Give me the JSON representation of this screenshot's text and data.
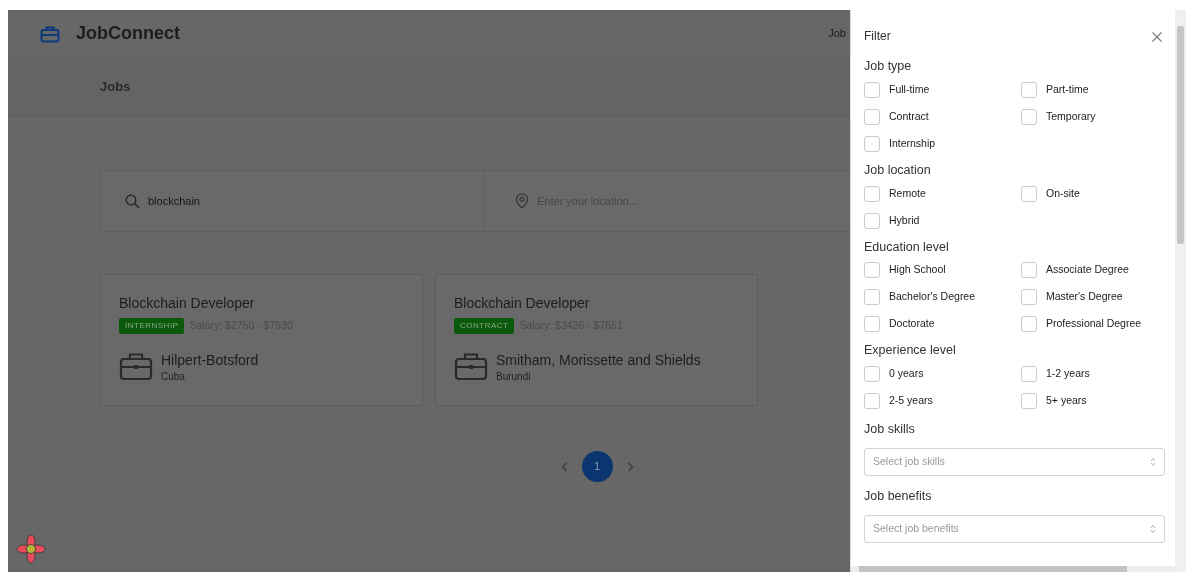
{
  "navbar": {
    "brand": "JobConnect",
    "link": "Job"
  },
  "page_header": {
    "title": "Jobs"
  },
  "search": {
    "query": "blockchain",
    "location_placeholder": "Enter your location..."
  },
  "jobs": [
    {
      "title": "Blockchain Developer",
      "type": "INTERNSHIP",
      "salary": "Salary: $2750 - $7930",
      "company": "Hilpert-Botsford",
      "country": "Cuba"
    },
    {
      "title": "Blockchain Developer",
      "type": "CONTRACT",
      "salary": "Salary: $3436 - $7651",
      "company": "Smitham, Morissette and Shields",
      "country": "Burundi"
    }
  ],
  "pagination": {
    "pages": [
      {
        "label": "1",
        "selected": true
      }
    ]
  },
  "filter": {
    "title": "Filter",
    "sections": [
      {
        "heading": "Job type",
        "kind": "checkboxes",
        "options": [
          {
            "label": "Full-time",
            "checked": false
          },
          {
            "label": "Part-time",
            "checked": false
          },
          {
            "label": "Contract",
            "checked": false
          },
          {
            "label": "Temporary",
            "checked": false
          },
          {
            "label": "Internship",
            "checked": false
          }
        ]
      },
      {
        "heading": "Job location",
        "kind": "checkboxes",
        "options": [
          {
            "label": "Remote",
            "checked": false
          },
          {
            "label": "On-site",
            "checked": false
          },
          {
            "label": "Hybrid",
            "checked": false
          }
        ]
      },
      {
        "heading": "Education level",
        "kind": "checkboxes",
        "options": [
          {
            "label": "High School",
            "checked": false
          },
          {
            "label": "Associate Degree",
            "checked": false
          },
          {
            "label": "Bachelor's Degree",
            "checked": false
          },
          {
            "label": "Master's Degree",
            "checked": false
          },
          {
            "label": "Doctorate",
            "checked": false
          },
          {
            "label": "Professional Degree",
            "checked": false
          }
        ]
      },
      {
        "heading": "Experience level",
        "kind": "checkboxes",
        "options": [
          {
            "label": "0 years",
            "checked": false
          },
          {
            "label": "1-2 years",
            "checked": false
          },
          {
            "label": "2-5 years",
            "checked": false
          },
          {
            "label": "5+ years",
            "checked": false
          }
        ]
      },
      {
        "heading": "Job skills",
        "kind": "select",
        "placeholder": "Select job skills"
      },
      {
        "heading": "Job benefits",
        "kind": "select",
        "placeholder": "Select job benefits"
      }
    ]
  }
}
